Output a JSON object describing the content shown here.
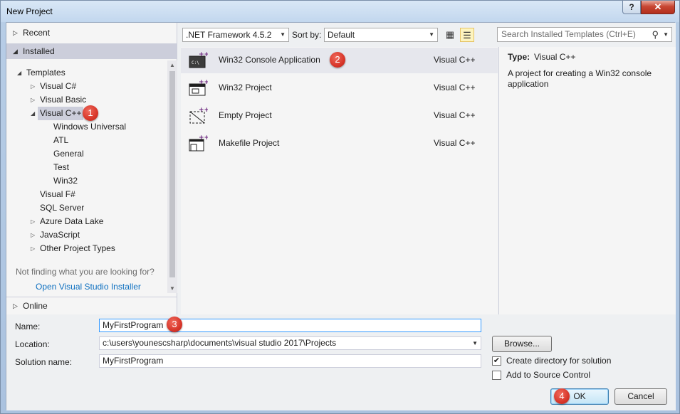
{
  "window": {
    "title": "New Project",
    "help_label": "?",
    "close_label": "✕"
  },
  "left": {
    "recent_label": "Recent",
    "installed_label": "Installed",
    "tree": [
      {
        "label": "Templates",
        "expander": "◢"
      },
      {
        "label": "Visual C#",
        "expander": "▷"
      },
      {
        "label": "Visual Basic",
        "expander": "▷"
      },
      {
        "label": "Visual C++",
        "expander": "◢"
      },
      {
        "label": "Windows Universal"
      },
      {
        "label": "ATL"
      },
      {
        "label": "General"
      },
      {
        "label": "Test"
      },
      {
        "label": "Win32"
      },
      {
        "label": "Visual F#"
      },
      {
        "label": "SQL Server"
      },
      {
        "label": "Azure Data Lake",
        "expander": "▷"
      },
      {
        "label": "JavaScript",
        "expander": "▷"
      },
      {
        "label": "Other Project Types",
        "expander": "▷"
      }
    ],
    "not_finding": "Not finding what you are looking for?",
    "installer_link": "Open Visual Studio Installer",
    "online_label": "Online"
  },
  "toolbar": {
    "framework": ".NET Framework 4.5.2",
    "sort_by_label": "Sort by:",
    "sort_value": "Default",
    "search_placeholder": "Search Installed Templates (Ctrl+E)"
  },
  "templates": [
    {
      "name": "Win32 Console Application",
      "language": "Visual C++",
      "icon": "console-app-icon"
    },
    {
      "name": "Win32 Project",
      "language": "Visual C++",
      "icon": "win32-project-icon"
    },
    {
      "name": "Empty Project",
      "language": "Visual C++",
      "icon": "empty-project-icon"
    },
    {
      "name": "Makefile Project",
      "language": "Visual C++",
      "icon": "makefile-project-icon"
    }
  ],
  "details": {
    "type_label": "Type:",
    "type_value": "Visual C++",
    "description": "A project for creating a Win32 console application"
  },
  "form": {
    "name_label": "Name:",
    "name_value": "MyFirstProgram",
    "location_label": "Location:",
    "location_value": "c:\\users\\younescsharp\\documents\\visual studio 2017\\Projects",
    "solution_label": "Solution name:",
    "solution_value": "MyFirstProgram",
    "browse_label": "Browse...",
    "create_dir_label": "Create directory for solution",
    "create_dir_checked": true,
    "source_control_label": "Add to Source Control",
    "source_control_checked": false,
    "ok_label": "OK",
    "cancel_label": "Cancel"
  },
  "callouts": [
    "1",
    "2",
    "3",
    "4"
  ],
  "colors": {
    "selection": "#cccedb",
    "link": "#0e70c0",
    "badge": "#d8362a",
    "icon_accent": "#68217a"
  }
}
